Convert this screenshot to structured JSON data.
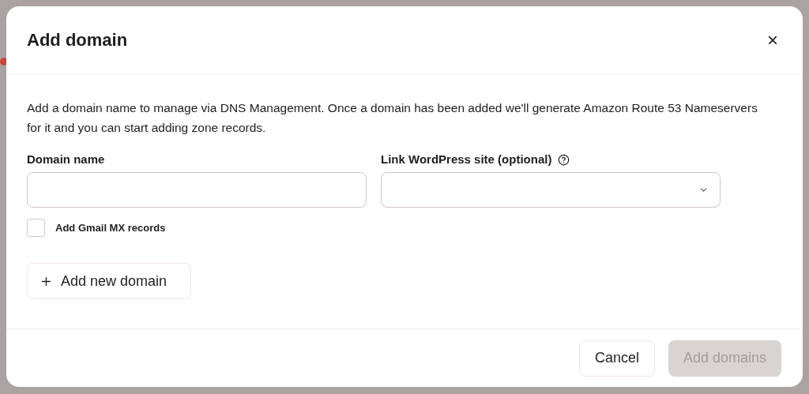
{
  "dialog": {
    "title": "Add domain",
    "close_label": "×"
  },
  "description": "Add a domain name to manage via DNS Management. Once a domain has been added we'll generate Amazon Route 53 Nameservers for it and you can start adding zone records.",
  "domain_field": {
    "label": "Domain name"
  },
  "site_select": {
    "label": "Link WordPress site (optional)"
  },
  "gmail_checkbox": {
    "label": "Add Gmail MX records",
    "checked": false
  },
  "add_new_button": {
    "label": "Add new domain"
  },
  "footer": {
    "buttons": [
      {
        "label": "Cancel",
        "kind": "secondary",
        "disabled": false
      },
      {
        "label": "Add domains",
        "kind": "primary",
        "disabled": true
      }
    ]
  }
}
